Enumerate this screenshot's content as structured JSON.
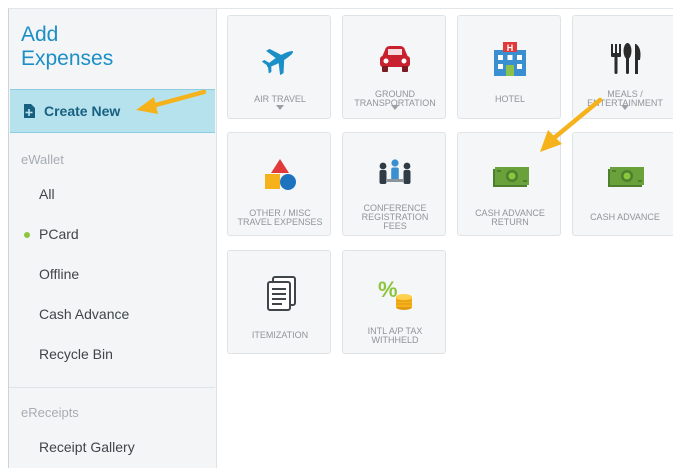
{
  "sidebar": {
    "title": "Add\nExpenses",
    "create_new_label": "Create New",
    "ewallet_header": "eWallet",
    "items": [
      {
        "label": "All",
        "active": false
      },
      {
        "label": "PCard",
        "active": true
      },
      {
        "label": "Offline",
        "active": false
      },
      {
        "label": "Cash Advance",
        "active": false
      },
      {
        "label": "Recycle Bin",
        "active": false
      }
    ],
    "ereceipts_header": "eReceipts",
    "receipt_gallery_label": "Receipt Gallery"
  },
  "tiles": [
    {
      "label": "AIR TRAVEL",
      "icon": "airplane-icon",
      "has_dropdown": true
    },
    {
      "label": "GROUND\nTRANSPORTATION",
      "icon": "car-icon",
      "has_dropdown": true
    },
    {
      "label": "HOTEL",
      "icon": "hotel-icon",
      "has_dropdown": false
    },
    {
      "label": "MEALS /\nENTERTAINMENT",
      "icon": "utensils-icon",
      "has_dropdown": true
    },
    {
      "label": "OTHER / MISC\nTRAVEL EXPENSES",
      "icon": "shapes-icon",
      "has_dropdown": false
    },
    {
      "label": "CONFERENCE\nREGISTRATION\nFEES",
      "icon": "people-icon",
      "has_dropdown": false
    },
    {
      "label": "CASH ADVANCE\nRETURN",
      "icon": "cash-icon",
      "has_dropdown": false
    },
    {
      "label": "CASH ADVANCE",
      "icon": "cash-icon",
      "has_dropdown": false
    },
    {
      "label": "ITEMIZATION",
      "icon": "itemization-icon",
      "has_dropdown": false
    },
    {
      "label": "INTL A/P TAX\nWITHHELD",
      "icon": "tax-coins-icon",
      "has_dropdown": false
    }
  ],
  "colors": {
    "accent": "#1b8fc6",
    "create_new_bg": "#b6e2ee",
    "annotation_arrow": "#f5b21b",
    "active_dot": "#8cc63f"
  }
}
